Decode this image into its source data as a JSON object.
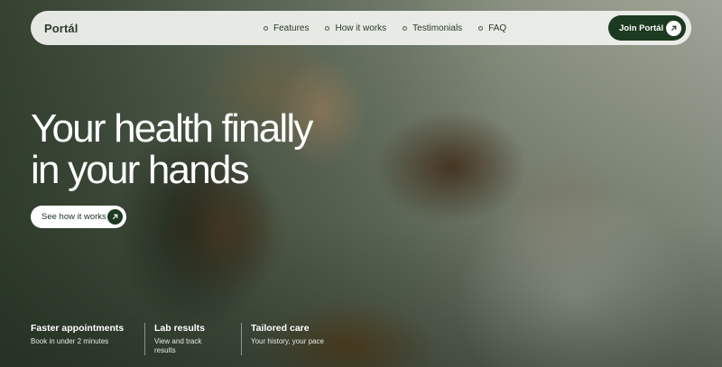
{
  "nav": {
    "logo": "Portál",
    "links": [
      {
        "label": "Features"
      },
      {
        "label": "How it works"
      },
      {
        "label": "Testimonials"
      },
      {
        "label": "FAQ"
      }
    ],
    "join_label": "Join Portál"
  },
  "hero": {
    "headline_line1": "Your health finally",
    "headline_line2": "in your hands",
    "cta_label": "See how it works"
  },
  "features": [
    {
      "title": "Faster appointments",
      "desc": "Book in under 2 minutes"
    },
    {
      "title": "Lab results",
      "desc": "View and track results"
    },
    {
      "title": "Tailored care",
      "desc": "Your history, your pace"
    }
  ],
  "colors": {
    "brand_dark_green": "#1c3a20",
    "nav_background": "#eef0ec",
    "text_light": "#ffffff"
  },
  "icons": {
    "join_button": "arrow-up-right-icon",
    "cta_button": "arrow-up-right-icon",
    "nav_bullet": "circle-outline-icon"
  },
  "image": {
    "subject": "family-photo"
  }
}
